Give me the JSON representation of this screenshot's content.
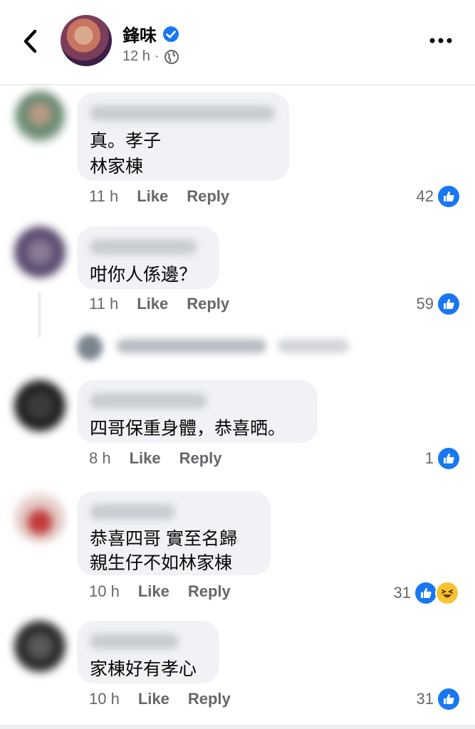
{
  "header": {
    "author": "鋒味",
    "time": "12 h",
    "separator": "·"
  },
  "comments": [
    {
      "text": "真。孝子\n林家棟",
      "time": "11 h",
      "like_label": "Like",
      "reply_label": "Reply",
      "reaction_count": "42",
      "reactions": [
        "like"
      ]
    },
    {
      "text": "咁你人係邊？",
      "time": "11 h",
      "like_label": "Like",
      "reply_label": "Reply",
      "reaction_count": "59",
      "reactions": [
        "like"
      ]
    },
    {
      "text": "四哥保重身體，恭喜晒。",
      "time": "8 h",
      "like_label": "Like",
      "reply_label": "Reply",
      "reaction_count": "1",
      "reactions": [
        "like"
      ]
    },
    {
      "text": "恭喜四哥  實至名歸\n親生仔不如林家棟",
      "time": "10 h",
      "like_label": "Like",
      "reply_label": "Reply",
      "reaction_count": "31",
      "reactions": [
        "like",
        "haha"
      ]
    },
    {
      "text": "家棟好有孝心",
      "time": "10 h",
      "like_label": "Like",
      "reply_label": "Reply",
      "reaction_count": "31",
      "reactions": [
        "like"
      ]
    }
  ],
  "colors": {
    "accent": "#1877f2",
    "bubble": "#f0f2f5",
    "secondary_text": "#65676b"
  },
  "icons": {
    "back": "chevron-left-icon",
    "verified": "verified-badge-icon",
    "privacy": "globe-icon",
    "more": "more-options-icon",
    "like": "like-icon",
    "haha": "haha-icon"
  }
}
